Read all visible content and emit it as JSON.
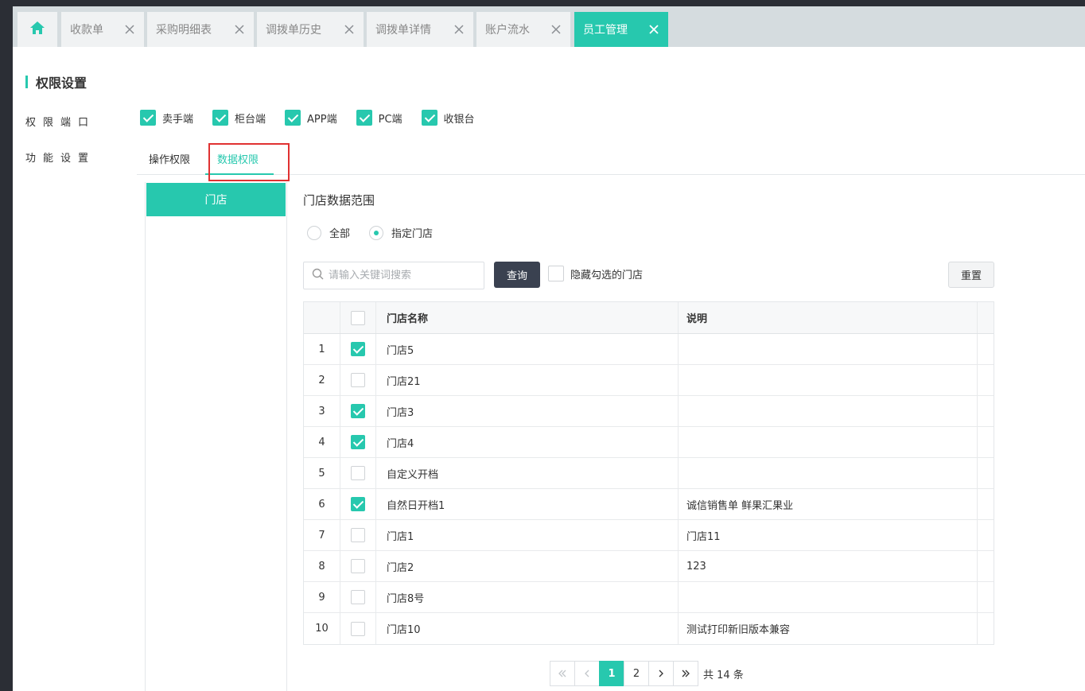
{
  "tabs": [
    {
      "label": "收款单"
    },
    {
      "label": "采购明细表"
    },
    {
      "label": "调拨单历史"
    },
    {
      "label": "调拨单详情"
    },
    {
      "label": "账户流水"
    },
    {
      "label": "员工管理",
      "active": true
    }
  ],
  "colors": {
    "accent": "#27c8ae",
    "dark_button": "#3a4150",
    "highlight": "#e03131"
  },
  "section_title": "权限设置",
  "side_nav": {
    "ports_label": "权限端口",
    "features_label": "功能设置"
  },
  "ports": [
    {
      "label": "卖手端",
      "checked": true
    },
    {
      "label": "柜台端",
      "checked": true
    },
    {
      "label": "APP端",
      "checked": true
    },
    {
      "label": "PC端",
      "checked": true
    },
    {
      "label": "收银台",
      "checked": true
    }
  ],
  "subtabs": {
    "operation": "操作权限",
    "data": "数据权限"
  },
  "category": {
    "store": "门店"
  },
  "range": {
    "title": "门店数据范围",
    "option_all": "全部",
    "option_specified": "指定门店",
    "selected": "指定门店"
  },
  "search": {
    "placeholder": "请输入关键词搜索",
    "query_label": "查询",
    "hide_checked_label": "隐藏勾选的门店",
    "reset_label": "重置"
  },
  "table": {
    "headers": {
      "name": "门店名称",
      "desc": "说明"
    },
    "rows": [
      {
        "num": "1",
        "checked": true,
        "name": "门店5",
        "desc": ""
      },
      {
        "num": "2",
        "checked": false,
        "name": "门店21",
        "desc": ""
      },
      {
        "num": "3",
        "checked": true,
        "name": "门店3",
        "desc": ""
      },
      {
        "num": "4",
        "checked": true,
        "name": "门店4",
        "desc": ""
      },
      {
        "num": "5",
        "checked": false,
        "name": "自定义开档",
        "desc": ""
      },
      {
        "num": "6",
        "checked": true,
        "name": "自然日开档1",
        "desc": "诚信销售单 鲜果汇果业"
      },
      {
        "num": "7",
        "checked": false,
        "name": "门店1",
        "desc": "门店11"
      },
      {
        "num": "8",
        "checked": false,
        "name": "门店2",
        "desc": "123"
      },
      {
        "num": "9",
        "checked": false,
        "name": "门店8号",
        "desc": ""
      },
      {
        "num": "10",
        "checked": false,
        "name": "门店10",
        "desc": "测试打印新旧版本兼容"
      }
    ]
  },
  "pager": {
    "first": "«",
    "prev": "‹",
    "pages": [
      "1",
      "2"
    ],
    "current": "1",
    "next": "›",
    "last": "»",
    "total": "共 14 条"
  }
}
